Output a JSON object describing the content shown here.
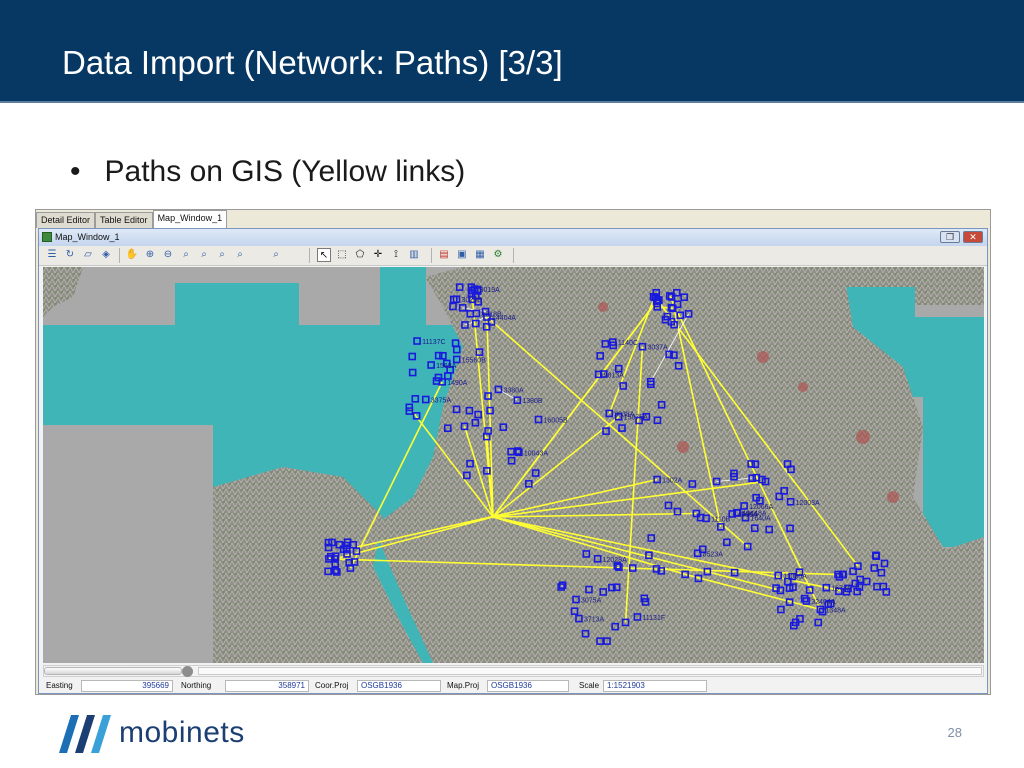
{
  "slide": {
    "title": "Data Import (Network: Paths) [3/3]",
    "bullet": "Paths on GIS (Yellow links)",
    "page_number": "28",
    "logo_text": "mobinets"
  },
  "screenshot": {
    "tabs": [
      {
        "label": "Detail Editor",
        "active": false
      },
      {
        "label": "Table Editor",
        "active": false
      },
      {
        "label": "Map_Window_1",
        "active": true
      }
    ],
    "window_title": "Map_Window_1",
    "map_site_labels": [
      "1490A",
      "3375A",
      "11137C",
      "15560B",
      "1568A",
      "10043A",
      "16005B",
      "1380B",
      "3380A",
      "9813A",
      "3038A",
      "15975A",
      "3037A",
      "1140C",
      "8523A",
      "1302A",
      "1110B",
      "1640A",
      "12028A",
      "11131F",
      "3075A",
      "3713A",
      "12003A",
      "4506A",
      "596A",
      "12066A",
      "13448A",
      "1348A",
      "32404A",
      "11090A",
      "1673A",
      "3019A",
      "1318B",
      "3020B",
      "14404A"
    ],
    "status": {
      "easting_label": "Easting",
      "easting_value": "395669",
      "northing_label": "Northing",
      "northing_value": "358971",
      "coor_proj_label": "Coor.Proj",
      "coor_proj_value": "OSGB1936",
      "map_proj_label": "Map.Proj",
      "map_proj_value": "OSGB1936",
      "scale_label": "Scale",
      "scale_value": "1:1521903"
    }
  },
  "colors": {
    "title_bar": "#073763",
    "sea": "#3fb5b8",
    "terrain": "#8e8e86",
    "site_marker": "#1a1adc",
    "path_link": "#ffff33"
  },
  "toolbar_icons": [
    "layers-icon",
    "refresh-icon",
    "open-icon",
    "save-icon",
    "pan-icon",
    "zoom-in-icon",
    "zoom-out-icon",
    "zoom-box-icon",
    "zoom-full-icon",
    "zoom-previous-icon",
    "zoom-next-icon",
    "zoom-layer-icon",
    "select-icon",
    "select-box-icon",
    "select-poly-icon",
    "crosshair-icon",
    "measure-icon",
    "histogram-icon",
    "legend-icon",
    "properties-icon",
    "export-icon",
    "build-icon"
  ]
}
